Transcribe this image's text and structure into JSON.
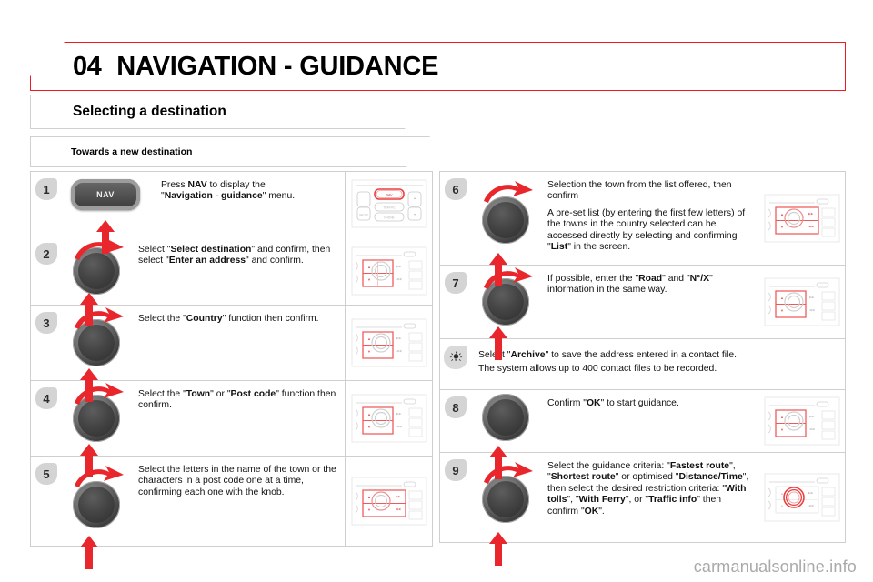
{
  "header": {
    "chapter_number": "04",
    "chapter_title": "NAVIGATION - GUIDANCE"
  },
  "sections": {
    "primary": "Selecting a destination",
    "secondary": "Towards a new destination"
  },
  "left_column": [
    {
      "number": "1",
      "art": "nav-button",
      "button_label": "NAV",
      "text_html": "Press <b>NAV</b> to display the <br>\"<b>Navigation - guidance</b>\" menu.",
      "device": "button-panel-nav"
    },
    {
      "number": "2",
      "art": "knob",
      "text_html": "Select \"<b>Select destination</b>\" and confirm, then select \"<b>Enter an address</b>\" and confirm.",
      "device": "knob-panel-updown"
    },
    {
      "number": "3",
      "art": "knob",
      "text_html": "Select the \"<b>Country</b>\" function then confirm.",
      "device": "knob-panel-updown"
    },
    {
      "number": "4",
      "art": "knob",
      "text_html": "Select the \"<b>Town</b>\" or \"<b>Post code</b>\" function then confirm.",
      "device": "knob-panel-updown"
    },
    {
      "number": "5",
      "art": "knob",
      "text_html": "Select the letters in the name of the town or the characters in a post code one at a time, confirming each one with the knob.",
      "device": "knob-panel-full"
    }
  ],
  "right_column": [
    {
      "number": "6",
      "art": "knob",
      "text_html": "Selection the town from the list offered, then confirm",
      "text_html_2": "A pre-set list (by entering the first few letters) of the towns in the country selected can be accessed directly by selecting and confirming \"<b>List</b>\" in the screen.",
      "device": "knob-panel-full"
    },
    {
      "number": "7",
      "art": "knob",
      "text_html": "If possible, enter the \"<b>Road</b>\" and \"<b>N°/X</b>\" information in the same way.",
      "device": "knob-panel-updown"
    },
    {
      "number": "tip",
      "art": "none",
      "icon": "lightbulb-icon",
      "text_html": "Select \"<b>Archive</b>\" to save the address entered in a contact file.",
      "text_html_2": "The system allows up to 400 contact files to be recorded."
    },
    {
      "number": "8",
      "art": "knob-press",
      "text_html": "Confirm \"<b>OK</b>\" to start guidance.",
      "device": "knob-panel-updown"
    },
    {
      "number": "9",
      "art": "knob",
      "text_html": "Select the guidance criteria: \"<b>Fastest route</b>\", \"<b>Shortest route</b>\" or optimised \"<b>Distance/Time</b>\", then select the desired restriction criteria: \"<b>With tolls</b>\", \"<b>With Ferry</b>\", or \"<b>Traffic info</b>\" then confirm \"<b>OK</b>\".",
      "device": "knob-panel-ring"
    }
  ],
  "device_labels": {
    "nav": "NAV",
    "traffic": "TRAFFIC",
    "phone": "PHONE",
    "setup": "SETUP"
  },
  "watermark": "carmanualsonline.info",
  "colors": {
    "accent_red": "#ed1c24",
    "arrow_red": "#e8262b",
    "badge_gray": "#d4d4d4",
    "border_gray": "#cfcfcf"
  }
}
